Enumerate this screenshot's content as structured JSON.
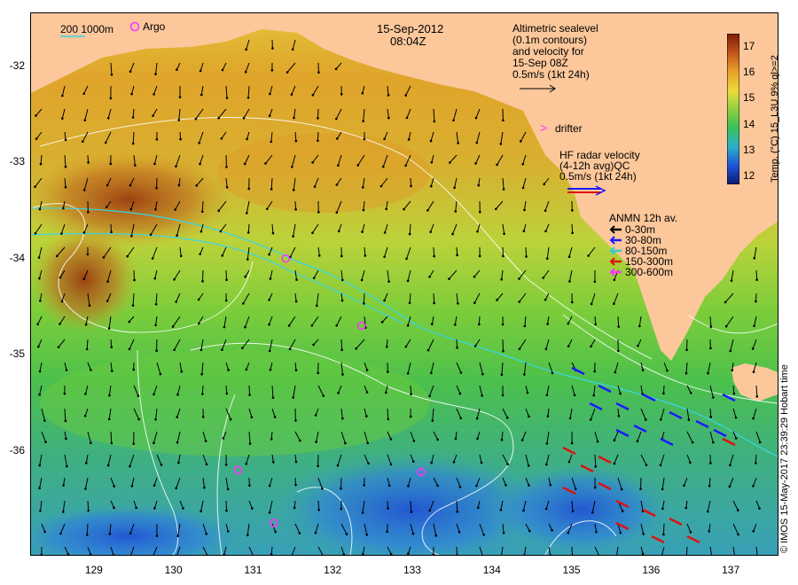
{
  "title": {
    "date": "15-Sep-2012",
    "time": "08:04Z"
  },
  "scale_legend": {
    "depths": "200  1000m",
    "argo_label": "Argo"
  },
  "altimetry_note": {
    "lines": [
      "Altimetric sealevel",
      "(0.1m contours)",
      "and velocity for",
      "15-Sep 08Z",
      "0.5m/s (1kt 24h)"
    ]
  },
  "drifter_label": "drifter",
  "hf_radar": {
    "lines": [
      "HF radar velocity",
      "(4-12h avg)QC",
      "0.5m/s (1kt 24h)"
    ]
  },
  "anmn": {
    "title": "ANMN 12h av.",
    "items": [
      {
        "label": "0-30m",
        "color": "#000000"
      },
      {
        "label": "30-80m",
        "color": "#1a1aff"
      },
      {
        "label": "80-150m",
        "color": "#33cccc"
      },
      {
        "label": "150-300m",
        "color": "#e01010"
      },
      {
        "label": "300-600m",
        "color": "#ff33ff"
      }
    ]
  },
  "colorbar": {
    "label": "Temp. (°C) 15_L3U 9% ql>=2",
    "ticks": [
      "17",
      "16",
      "15",
      "14",
      "13",
      "12"
    ],
    "min": 11.7,
    "max": 17.5
  },
  "axes": {
    "x_ticks": [
      "129",
      "130",
      "131",
      "132",
      "133",
      "134",
      "135",
      "136",
      "137"
    ],
    "y_ticks": [
      "-32",
      "-33",
      "-34",
      "-35",
      "-36"
    ],
    "lon_range": [
      128.2,
      137.6
    ],
    "lat_range": [
      -31.45,
      -37.1
    ]
  },
  "argo_floats": [
    {
      "lon": 131.4,
      "lat": -34.0
    },
    {
      "lon": 132.35,
      "lat": -34.7
    },
    {
      "lon": 130.8,
      "lat": -36.2
    },
    {
      "lon": 133.1,
      "lat": -36.22
    },
    {
      "lon": 131.25,
      "lat": -36.75
    }
  ],
  "copyright": "© IMOS 15-May-2017 23:39:29 Hobart time",
  "colors": {
    "land": "#fcc79a",
    "argo": "#ff33ff"
  }
}
